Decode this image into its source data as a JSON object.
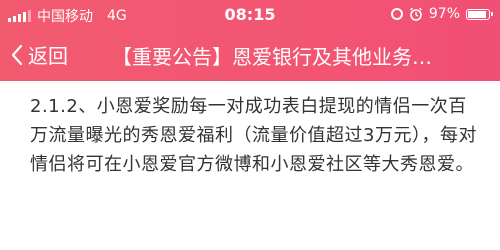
{
  "status_bar": {
    "carrier": "中国移动",
    "network": "4G",
    "time": "08:15",
    "battery_percent": "97%",
    "battery_level": 0.97,
    "icons": [
      "signal-icon",
      "rotation-lock-icon",
      "alarm-icon",
      "battery-icon"
    ]
  },
  "nav": {
    "back_label": "返回",
    "title": "【重要公告】恩爱银行及其他业务…"
  },
  "content": {
    "paragraph": "2.1.2、小恩爱奖励每一对成功表白提现的情侣一次百万流量曝光的秀恩爱福利（流量价值超过3万元），每对情侣将可在小恩爱官方微博和小恩爱社区等大秀恩爱。"
  },
  "colors": {
    "header_start": "#f15b70",
    "header_end": "#f14f75",
    "text": "#333333"
  }
}
